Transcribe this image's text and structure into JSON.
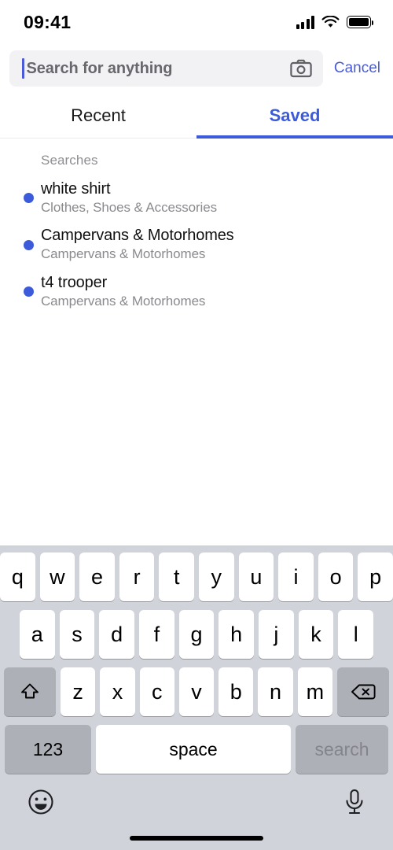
{
  "status_bar": {
    "time": "09:41",
    "signal_icon": "cellular-signal-icon",
    "wifi_icon": "wifi-icon",
    "battery_icon": "battery-full-icon"
  },
  "search": {
    "placeholder": "Search for anything",
    "value": "",
    "camera_icon": "camera-icon",
    "cancel_label": "Cancel"
  },
  "tabs": [
    {
      "label": "Recent",
      "active": false
    },
    {
      "label": "Saved",
      "active": true
    }
  ],
  "content": {
    "section_header": "Searches",
    "items": [
      {
        "title": "white shirt",
        "subtitle": "Clothes, Shoes & Accessories"
      },
      {
        "title": "Campervans & Motorhomes",
        "subtitle": "Campervans & Motorhomes"
      },
      {
        "title": "t4 trooper",
        "subtitle": "Campervans & Motorhomes"
      }
    ]
  },
  "keyboard": {
    "row1": [
      "q",
      "w",
      "e",
      "r",
      "t",
      "y",
      "u",
      "i",
      "o",
      "p"
    ],
    "row2": [
      "a",
      "s",
      "d",
      "f",
      "g",
      "h",
      "j",
      "k",
      "l"
    ],
    "row3": [
      "z",
      "x",
      "c",
      "v",
      "b",
      "n",
      "m"
    ],
    "shift_icon": "shift-icon",
    "backspace_icon": "backspace-icon",
    "numbers_label": "123",
    "space_label": "space",
    "return_label": "search",
    "emoji_icon": "emoji-icon",
    "dictation_icon": "microphone-icon"
  },
  "colors": {
    "accent": "#3b5bdb",
    "cancel_link": "#4b5bd7",
    "placeholder_text": "#67676c",
    "subtitle_text": "#8a8a8f",
    "keyboard_bg": "#d1d3da",
    "key_bg": "#ffffff",
    "fn_key_bg": "#aeb0b8",
    "search_field_bg": "#f2f2f5"
  }
}
